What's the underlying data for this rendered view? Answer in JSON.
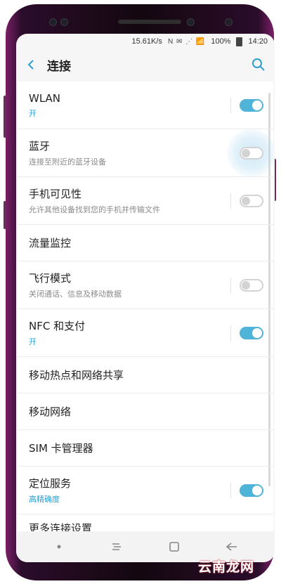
{
  "statusbar": {
    "network_speed": "15.61K/s",
    "signal_icons": "N ✉ ⋰ 📶",
    "battery": "100%",
    "time": "14:20"
  },
  "header": {
    "title": "连接",
    "back_icon": "back-arrow-icon",
    "search_icon": "search-icon"
  },
  "items": [
    {
      "label": "WLAN",
      "sub": "开",
      "sub_accent": true,
      "toggle": "on"
    },
    {
      "label": "蓝牙",
      "sub": "连接至附近的蓝牙设备",
      "sub_accent": false,
      "toggle": "off",
      "pressed": true
    },
    {
      "label": "手机可见性",
      "sub": "允许其他设备找到您的手机并传输文件",
      "sub_accent": false,
      "toggle": "off"
    },
    {
      "label": "流量监控"
    },
    {
      "label": "飞行模式",
      "sub": "关闭通话、信息及移动数据",
      "sub_accent": false,
      "toggle": "off"
    },
    {
      "label": "NFC 和支付",
      "sub": "开",
      "sub_accent": true,
      "toggle": "on"
    },
    {
      "label": "移动热点和网络共享"
    },
    {
      "label": "移动网络"
    },
    {
      "label": "SIM 卡管理器"
    },
    {
      "label": "定位服务",
      "sub": "高精确度",
      "sub_accent": true,
      "toggle": "on"
    },
    {
      "label": "更多连接设置"
    }
  ],
  "navbar": {
    "home_icon": "home-dot-icon",
    "recents_icon": "recents-icon",
    "overview_icon": "overview-square-icon",
    "back_icon": "back-nav-icon"
  },
  "colors": {
    "accent": "#4fb4d8",
    "sub_accent": "#2f9fd0",
    "frame": "#7a1f66"
  },
  "watermark": "云南龙网"
}
